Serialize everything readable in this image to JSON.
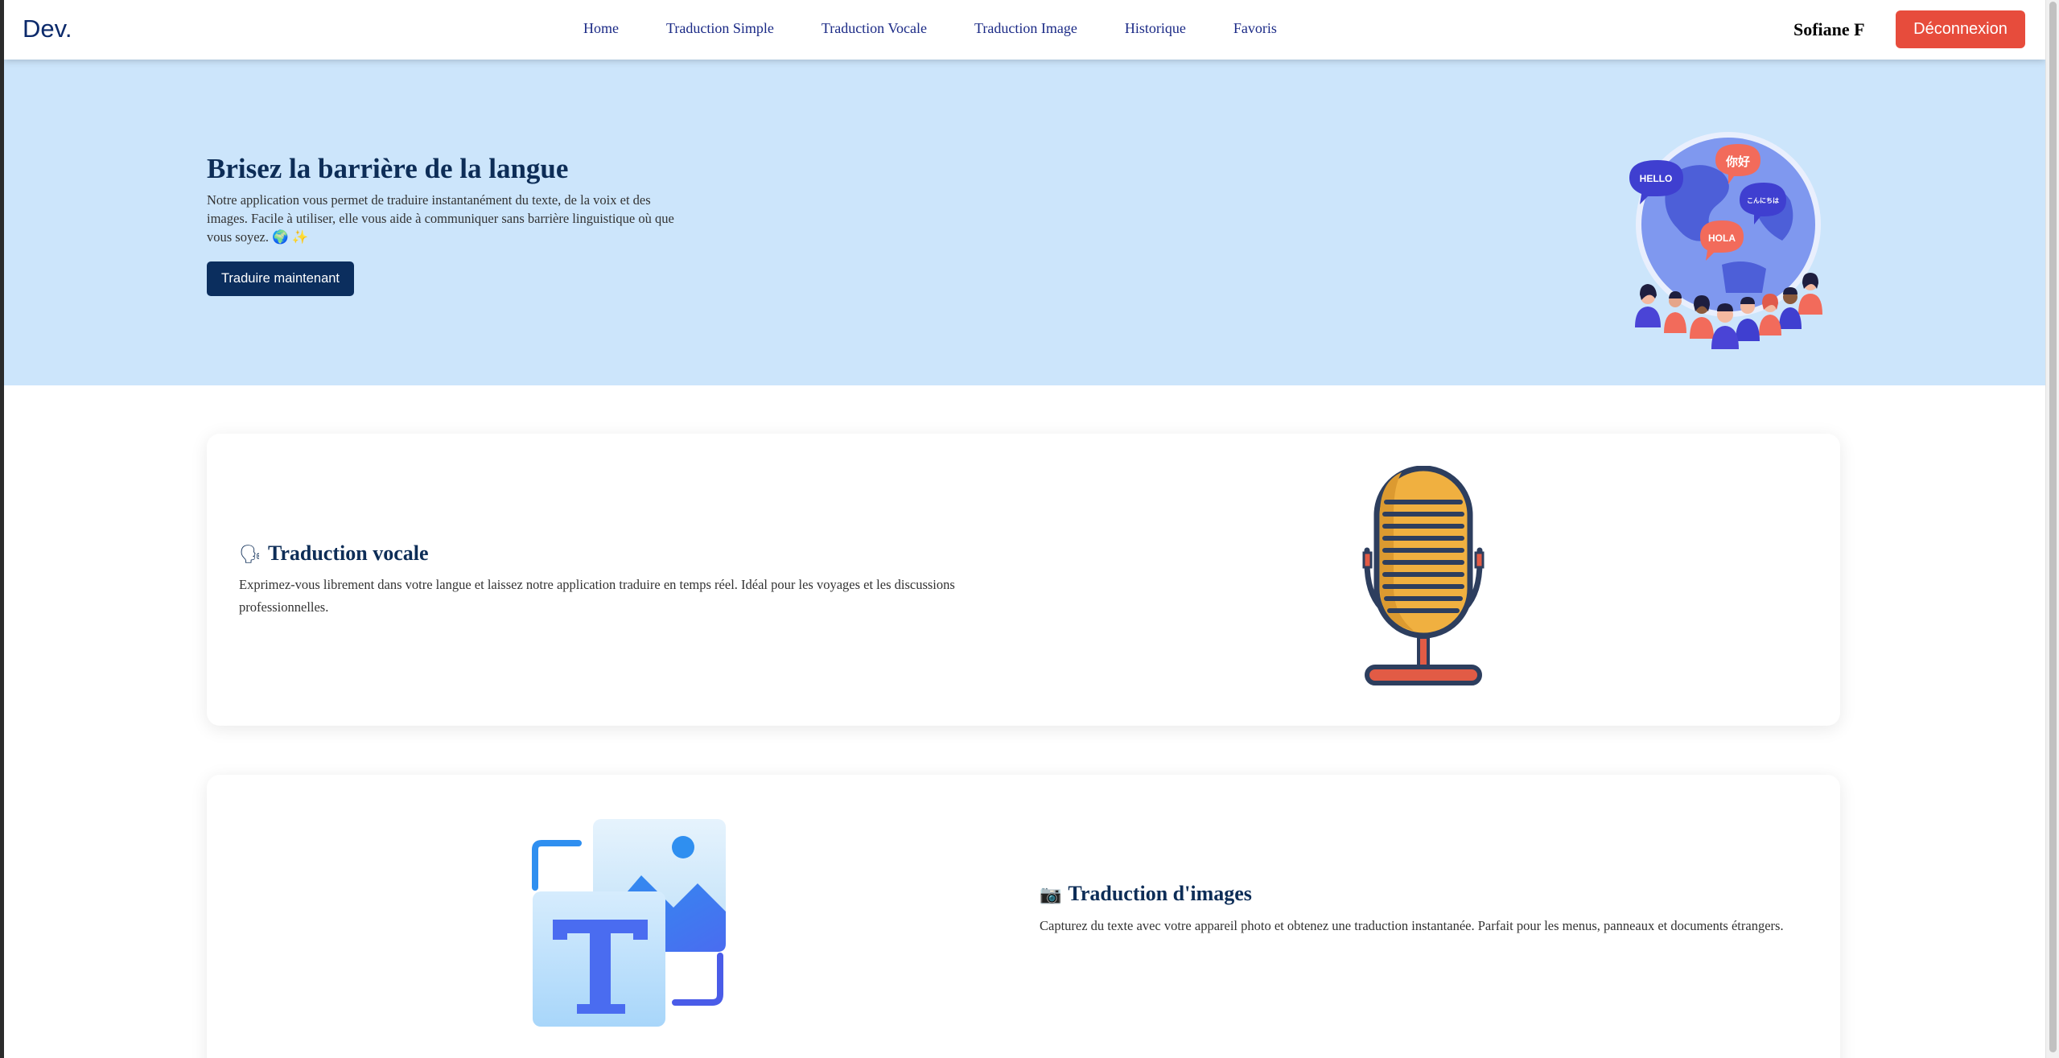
{
  "nav": {
    "logo": "Dev.",
    "links": [
      "Home",
      "Traduction Simple",
      "Traduction Vocale",
      "Traduction Image",
      "Historique",
      "Favoris"
    ],
    "user_name": "Sofiane F",
    "logout_label": "Déconnexion"
  },
  "hero": {
    "title": "Brisez la barrière de la langue",
    "text": "Notre application vous permet de traduire instantanément du texte, de la voix et des images. Facile à utiliser, elle vous aide à communiquer sans barrière linguistique où que vous soyez. 🌍 ✨",
    "cta_label": "Traduire maintenant",
    "bubbles": [
      "HELLO",
      "你好",
      "こんにちは",
      "HOLA"
    ]
  },
  "features": {
    "voice": {
      "emoji": "🗣",
      "title": "Traduction vocale",
      "text": "Exprimez-vous librement dans votre langue et laissez notre application traduire en temps réel. Idéal pour les voyages et les discussions professionnelles."
    },
    "image": {
      "emoji": "📷",
      "title": "Traduction d'images",
      "text": "Capturez du texte avec votre appareil photo et obtenez une traduction instantanée. Parfait pour les menus, panneaux et documents étrangers."
    }
  },
  "colors": {
    "hero_bg": "#cce5fb",
    "navy": "#0b2e5e",
    "logout_red": "#e74c3c",
    "nav_link": "#1b2a86"
  }
}
